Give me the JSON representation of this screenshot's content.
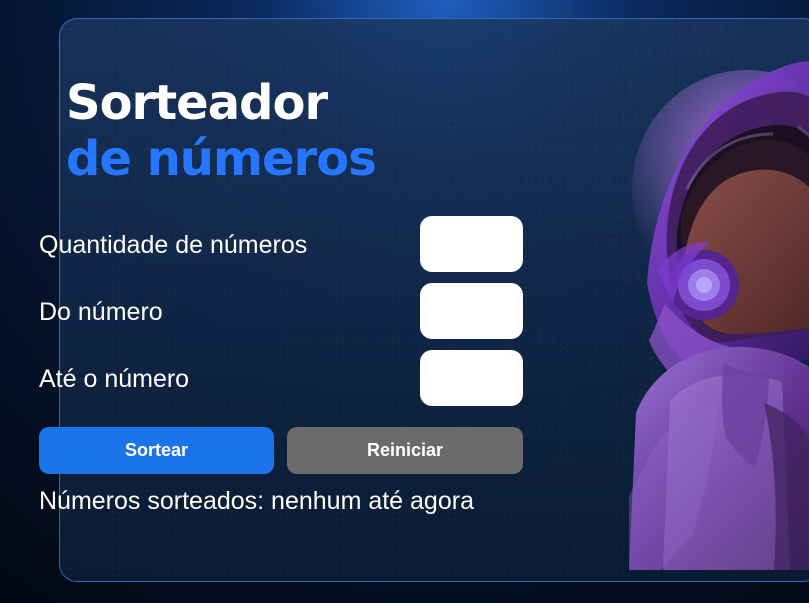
{
  "title": {
    "line1": "Sorteador",
    "line2": "de números"
  },
  "form": {
    "fields": [
      {
        "label": "Quantidade de números",
        "value": ""
      },
      {
        "label": "Do número",
        "value": ""
      },
      {
        "label": "Até o número",
        "value": ""
      }
    ]
  },
  "buttons": {
    "draw": "Sortear",
    "reset": "Reiniciar"
  },
  "result_text": "Números sorteados: nenhum até agora",
  "background_code": [
    "00100111010",
    "01100 01100010",
    "000101110000",
    "0011101101000",
    "0000111110000",
    "00 101000010",
    "001000011000",
    "00 1010",
    "00010001",
    "1100000 11000",
    "1100001 110010",
    "111010000 01",
    "1101000 110000010100",
    "10100 0100"
  ],
  "colors": {
    "accent": "#2676ff",
    "primary_button": "#1c74ea",
    "secondary_button": "#6b6b6b",
    "card_border": "#468cff"
  },
  "icons": {
    "illustration": "astronaut-girl-illustration"
  }
}
